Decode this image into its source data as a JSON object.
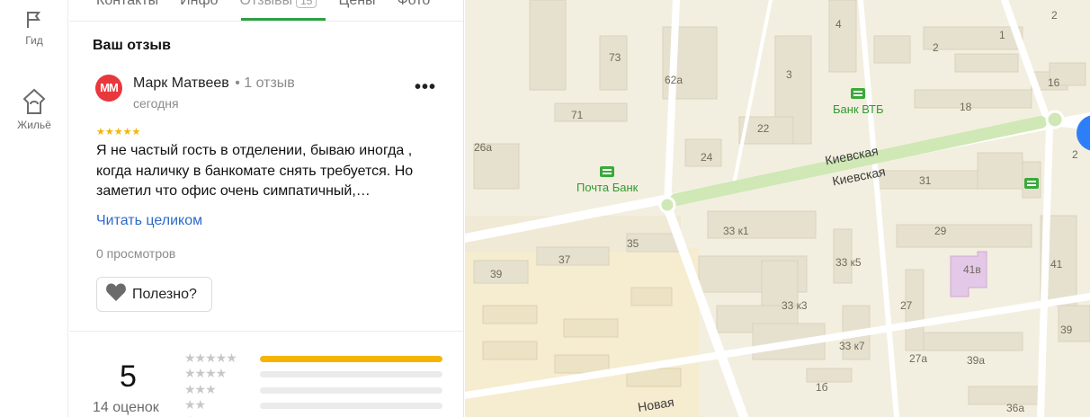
{
  "rail": {
    "items": [
      {
        "label": "Гид",
        "icon": "flag-icon"
      },
      {
        "label": "Жильё",
        "icon": "house-icon"
      }
    ]
  },
  "tabs": [
    {
      "label": "Контакты"
    },
    {
      "label": "Инфо"
    },
    {
      "label": "Отзывы",
      "count": "15",
      "active": true
    },
    {
      "label": "Цены"
    },
    {
      "label": "Фото"
    }
  ],
  "review": {
    "section_title": "Ваш отзыв",
    "avatar_initials": "ММ",
    "author": "Марк Матвеев",
    "author_meta": "• 1 отзыв",
    "date": "сегодня",
    "stars": "★★★★★",
    "text": "Я не частый гость в отделении, бываю иногда , когда наличку в банкомате снять требуется. Но заметил что офис очень симпатичный,…",
    "read_more": "Читать целиком",
    "views": "0 просмотров",
    "useful_label": "Полезно?",
    "more_label": "•••"
  },
  "rating": {
    "value": "5",
    "count_label": "14 оценок",
    "distribution": [
      {
        "stars": "★★★★★",
        "share": 1.0
      },
      {
        "stars": "★★★★",
        "share": 0.0
      },
      {
        "stars": "★★★",
        "share": 0.0
      },
      {
        "stars": "★★",
        "share": 0.0
      },
      {
        "stars": "★",
        "share": 0.0
      }
    ]
  },
  "map": {
    "colors": {
      "base": "#f3efe0",
      "building": "#e6e1cf",
      "road": "#ffffff",
      "green": "#cfe8b5",
      "lilac": "#e3c8e8",
      "accent": "#2d7ff9"
    },
    "streets": [
      {
        "name": "Киевская"
      },
      {
        "name": "Киевская"
      },
      {
        "name": "Новая"
      }
    ],
    "pois": [
      {
        "name": "Банк ВТБ"
      },
      {
        "name": "Почта Банк"
      }
    ],
    "house_numbers": [
      "73",
      "62а",
      "3",
      "4",
      "2",
      "1",
      "2",
      "16",
      "18",
      "22",
      "71",
      "26а",
      "24",
      "31",
      "29",
      "41в",
      "41",
      "33 к1",
      "33 к5",
      "35",
      "37",
      "39",
      "33 к3",
      "27",
      "33 к7",
      "27а",
      "39а",
      "39",
      "1б",
      "36а",
      "2"
    ]
  }
}
